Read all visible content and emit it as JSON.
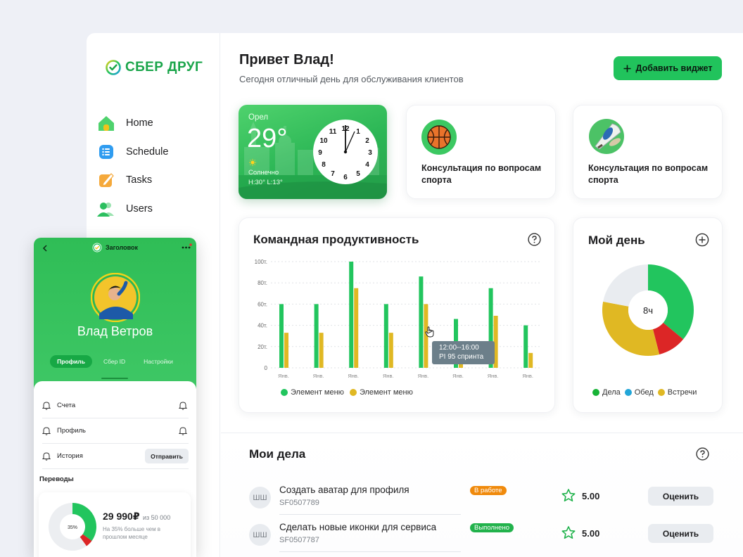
{
  "brand": {
    "logo_text": "СБЕР ДРУГ"
  },
  "sidebar": {
    "items": [
      {
        "label": "Home",
        "icon": "home-icon"
      },
      {
        "label": "Schedule",
        "icon": "schedule-icon"
      },
      {
        "label": "Tasks",
        "icon": "tasks-icon"
      },
      {
        "label": "Users",
        "icon": "users-icon"
      }
    ]
  },
  "header": {
    "title": "Привет Влад!",
    "subtitle": "Сегодня отличный день для обслуживания клиентов",
    "add_widget_label": "Добавить виджет"
  },
  "weather": {
    "city": "Орел",
    "temp": "29°",
    "condition": "Солнечно",
    "high_low": "H:30° L:13°",
    "clock_numbers": [
      "12",
      "1",
      "2",
      "3",
      "4",
      "5",
      "6",
      "7",
      "8",
      "9",
      "10",
      "11"
    ]
  },
  "sport_cards": [
    {
      "title": "Консультация по вопросам спорта",
      "icon": "basketball-icon"
    },
    {
      "title": "Консультация по вопросам спорта",
      "icon": "badminton-icon"
    }
  ],
  "productivity": {
    "title": "Командная продуктивность",
    "tooltip": {
      "line1": "12:00--16:00",
      "line2": "PI 95 спринта"
    }
  },
  "myday": {
    "title": "Мой день",
    "center_label": "8ч",
    "legend": [
      "Дела",
      "Обед",
      "Встречи"
    ],
    "colors": {
      "green": "#22c55e",
      "red": "#dc2626",
      "yellow": "#e0b823",
      "gray": "#e9ecf0",
      "blue": "#22a6d8"
    }
  },
  "tasks": {
    "title": "Мои дела",
    "items": [
      {
        "avatar": "ШШ",
        "name": "Создать аватар для профиля",
        "code": "SF0507789",
        "status": "В работе",
        "status_color": "#f08a0c",
        "score": "5.00",
        "action": "Оценить"
      },
      {
        "avatar": "ШШ",
        "name": "Сделать новые иконки для сервиса",
        "code": "SF0507787",
        "status": "Выполнено",
        "status_color": "#22b24c",
        "score": "5.00",
        "action": "Оценить"
      }
    ]
  },
  "phone": {
    "header_title": "Заголовок",
    "user_name": "Влад Ветров",
    "tabs": [
      "Профиль",
      "Сбер ID",
      "Настройки"
    ],
    "rows": [
      {
        "label": "Счета"
      },
      {
        "label": "Профиль"
      },
      {
        "label": "История",
        "action": "Отправить"
      }
    ],
    "section_title": "Переводы",
    "transfer": {
      "amount": "29 990₽",
      "of_text": "из 50 000",
      "note": "На 35% больше чем в прошлом месяце",
      "percent_label": "35%",
      "percent": 0.35
    }
  },
  "chart_data": [
    {
      "type": "bar",
      "categories": [
        "Янв.",
        "Янв.",
        "Янв.",
        "Янв.",
        "Янв.",
        "Янв.",
        "Янв.",
        "Янв."
      ],
      "y_ticks": [
        "0",
        "20т.",
        "40т.",
        "60т.",
        "80т.",
        "100т."
      ],
      "ylim": [
        0,
        100
      ],
      "grid": true,
      "legend_position": "bottom",
      "series": [
        {
          "name": "Элемент меню",
          "color": "#22c55e",
          "values": [
            60,
            60,
            100,
            60,
            86,
            46,
            75,
            40
          ]
        },
        {
          "name": "Элемент меню",
          "color": "#e0b823",
          "values": [
            33,
            33,
            75,
            33,
            60,
            23,
            49,
            14
          ]
        }
      ]
    },
    {
      "type": "pie",
      "labels": [
        "Дела",
        "",
        "Встречи",
        ""
      ],
      "values": [
        36,
        10,
        32,
        22
      ],
      "colors": [
        "#22c55e",
        "#dc2626",
        "#e0b823",
        "#e9ecf0"
      ]
    }
  ]
}
